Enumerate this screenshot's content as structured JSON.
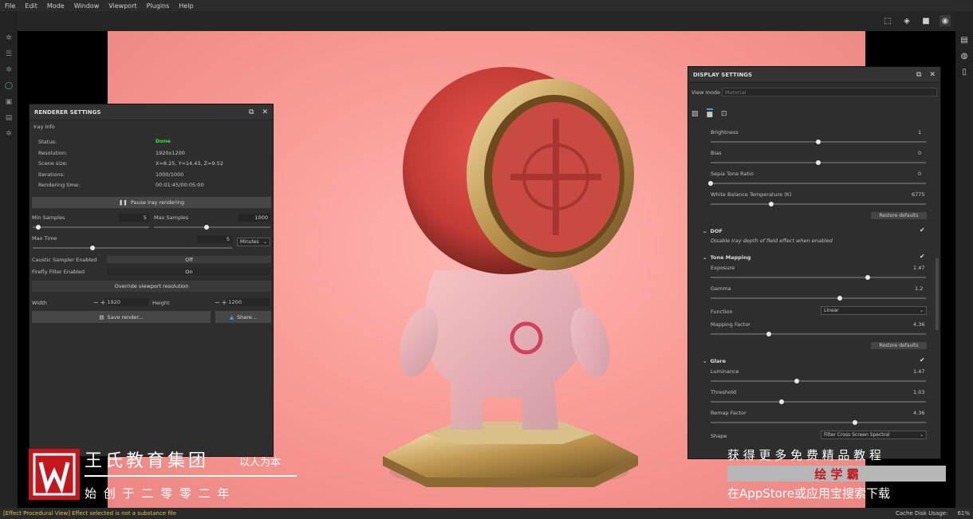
{
  "menu": [
    "File",
    "Edit",
    "Mode",
    "Window",
    "Viewport",
    "Plugins",
    "Help"
  ],
  "renderer": {
    "title": "RENDERER SETTINGS",
    "section": "Iray Info",
    "info": [
      {
        "label": "Status:",
        "value": "Done"
      },
      {
        "label": "Resolution:",
        "value": "1920x1200"
      },
      {
        "label": "Scene size:",
        "value": "X=8.25, Y=14.43, Z=9.52"
      },
      {
        "label": "Iterations:",
        "value": "1000/1000"
      },
      {
        "label": "Rendering time:",
        "value": "00:01:45/00:05:00"
      }
    ],
    "pause_label": "Pause Iray rendering",
    "min_samples_label": "Min Samples",
    "min_samples": "5",
    "min_samples_level": 0.05,
    "max_samples_label": "Max Samples",
    "max_samples": "1000",
    "max_samples_level": 0.45,
    "max_time_label": "Max Time",
    "max_time": "5",
    "max_time_level": 0.3,
    "time_unit": "Minutes",
    "caustic_label": "Caustic Sampler Enabled",
    "caustic_value": "Off",
    "firefly_label": "Firefly Filter Enabled",
    "firefly_value": "On",
    "override_label": "Override viewport resolution",
    "width_label": "Width",
    "width_value": "1920",
    "height_label": "Height",
    "height_value": "1200",
    "save_label": "Save render...",
    "share_label": "Share..."
  },
  "display": {
    "title": "DISPLAY SETTINGS",
    "view_mode_label": "View mode",
    "view_mode_value": "Material",
    "sliders1": [
      {
        "label": "Brightness",
        "value": "1",
        "level": 0.5
      },
      {
        "label": "Bias",
        "value": "0",
        "level": 0.5
      },
      {
        "label": "Sepia Tone Ratio",
        "value": "0",
        "level": 0.0
      },
      {
        "label": "White Balance Temperature (K)",
        "value": "6775",
        "level": 0.28
      }
    ],
    "restore_label": "Restore defaults",
    "dof_title": "DOF",
    "dof_desc": "Disable Iray depth of field effect when enabled",
    "tone_title": "Tone Mapping",
    "tone_sliders": [
      {
        "label": "Exposure",
        "value": "1.47",
        "level": 0.73
      },
      {
        "label": "Gamma",
        "value": "1.2",
        "level": 0.6
      }
    ],
    "function_label": "Function",
    "function_value": "Linear",
    "mapping_label": "Mapping Factor",
    "mapping_value": "4.36",
    "mapping_level": 0.27,
    "glare_title": "Glare",
    "glare_sliders": [
      {
        "label": "Luminance",
        "value": "1.47",
        "level": 0.4
      },
      {
        "label": "Threshold",
        "value": "1.03",
        "level": 0.33
      },
      {
        "label": "Remap Factor",
        "value": "4.36",
        "level": 0.67
      }
    ],
    "shape_label": "Shape",
    "shape_value": "Filter Cross Screen Spectral"
  },
  "watermark": {
    "company": "王氏教育集团",
    "motto": "以人为本",
    "since": "始 创 于 二 零 零 二 年",
    "promo": "获 得 更 多 免 费 精 品 教 程",
    "app": "绘 学 霸",
    "store": "在AppStore或应用宝搜索下载"
  },
  "status": {
    "error": "[Effect Procedural View] Effect selected is not a substance file",
    "cache_label": "Cache Disk Usage:",
    "cache_value": "61%"
  }
}
